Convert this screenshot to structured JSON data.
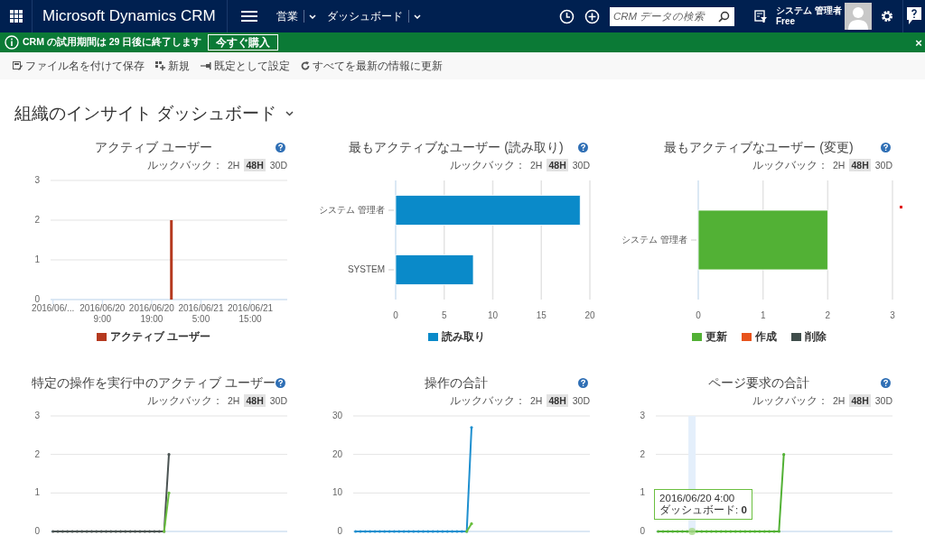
{
  "header": {
    "app_title": "Microsoft Dynamics CRM",
    "nav": [
      {
        "label": "営業"
      },
      {
        "label": "ダッシュボード"
      }
    ],
    "search": {
      "placeholder": "CRM データの検索"
    },
    "user": {
      "name": "システム 管理者",
      "org": "Free"
    }
  },
  "notification": {
    "message": "CRM の試用期間は 29 日後に終了します",
    "button": "今すぐ購入",
    "close": "×"
  },
  "toolbar": [
    {
      "label": "ファイル名を付けて保存",
      "kind": "save"
    },
    {
      "label": "新規",
      "kind": "new"
    },
    {
      "label": "既定として設定",
      "kind": "pin"
    },
    {
      "label": "すべてを最新の情報に更新",
      "kind": "refresh"
    }
  ],
  "dashboard": {
    "title": "組織のインサイト ダッシュボード"
  },
  "panels": [
    {
      "title": "アクティブ ユーザー",
      "lookback_label": "ルックバック：",
      "lookback": [
        {
          "label": "2H",
          "selected": false
        },
        {
          "label": "48H",
          "selected": true
        },
        {
          "label": "30D",
          "selected": false
        }
      ],
      "chart_data": {
        "type": "bar",
        "orientation": "vertical",
        "grid": true,
        "ylim": [
          0,
          3
        ],
        "yticks": [
          0,
          1,
          2,
          3
        ],
        "categories": [
          "2016/06/...",
          null,
          null,
          null,
          null,
          null,
          null,
          null,
          null,
          null,
          "2016/06/20\n9:00",
          null,
          null,
          null,
          null,
          null,
          null,
          null,
          null,
          null,
          "2016/06/20\n19:00",
          null,
          null,
          null,
          null,
          null,
          null,
          null,
          null,
          null,
          "2016/06/21\n5:00",
          null,
          null,
          null,
          null,
          null,
          null,
          null,
          null,
          null,
          "2016/06/21\n15:00",
          null,
          null,
          null,
          null,
          null,
          null,
          null
        ],
        "series": [
          {
            "name": "アクティブ ユーザー",
            "color": "#b5391f",
            "values": [
              null,
              null,
              null,
              null,
              null,
              null,
              null,
              null,
              null,
              null,
              null,
              null,
              null,
              null,
              null,
              null,
              null,
              null,
              null,
              null,
              null,
              null,
              null,
              null,
              2,
              null,
              null,
              null,
              null,
              null,
              null,
              null,
              null,
              null,
              null,
              null,
              null,
              null,
              null,
              null,
              null,
              null,
              null,
              null,
              null,
              null,
              null,
              null
            ]
          }
        ]
      }
    },
    {
      "title": "最もアクティブなユーザー (読み取り)",
      "lookback_label": "ルックバック：",
      "lookback": [
        {
          "label": "2H",
          "selected": false
        },
        {
          "label": "48H",
          "selected": true
        },
        {
          "label": "30D",
          "selected": false
        }
      ],
      "chart_data": {
        "type": "bar",
        "orientation": "horizontal",
        "grid": true,
        "categories": [
          "システム 管理者",
          "SYSTEM"
        ],
        "xlim": [
          0,
          20
        ],
        "xticks": [
          0,
          5,
          10,
          15,
          20
        ],
        "series": [
          {
            "name": "読み取り",
            "color": "#0a8ac9",
            "values": [
              19,
              8
            ]
          }
        ]
      }
    },
    {
      "title": "最もアクティブなユーザー (変更)",
      "lookback_label": "ルックバック：",
      "lookback": [
        {
          "label": "2H",
          "selected": false
        },
        {
          "label": "48H",
          "selected": true
        },
        {
          "label": "30D",
          "selected": false
        }
      ],
      "chart_data": {
        "type": "bar",
        "orientation": "horizontal",
        "grid": true,
        "categories": [
          "システム 管理者"
        ],
        "xlim": [
          0,
          3
        ],
        "xticks": [
          0,
          1,
          2,
          3
        ],
        "series": [
          {
            "name": "更新",
            "color": "#52b135",
            "values": [
              2
            ]
          },
          {
            "name": "作成",
            "color": "#e8531c",
            "values": [
              0
            ]
          },
          {
            "name": "削除",
            "color": "#3f4d4a",
            "values": [
              0
            ]
          }
        ]
      }
    },
    {
      "title": "特定の操作を実行中のアクティブ ユーザー",
      "lookback_label": "ルックバック：",
      "lookback": [
        {
          "label": "2H",
          "selected": false
        },
        {
          "label": "48H",
          "selected": true
        },
        {
          "label": "30D",
          "selected": false
        }
      ],
      "chart_data": {
        "type": "line",
        "grid": true,
        "categories": [
          null,
          null,
          null,
          null,
          null,
          null,
          null,
          null,
          null,
          null,
          null,
          null,
          null,
          null,
          null,
          null,
          null,
          null,
          null,
          null,
          null,
          null,
          null,
          null,
          null,
          null,
          null,
          null,
          null,
          null,
          null,
          null,
          null,
          null,
          null,
          null,
          null,
          null,
          null,
          null,
          null,
          null,
          null,
          null,
          null,
          null,
          null,
          null,
          null
        ],
        "ylim": [
          0,
          3
        ],
        "yticks": [
          0,
          1,
          2,
          3
        ],
        "series": [
          {
            "color": "#4a5352",
            "values": [
              0,
              0,
              0,
              0,
              0,
              0,
              0,
              0,
              0,
              0,
              0,
              0,
              0,
              0,
              0,
              0,
              0,
              0,
              0,
              0,
              0,
              0,
              0,
              0,
              2,
              null,
              null,
              null,
              null,
              null,
              null,
              null,
              null,
              null,
              null,
              null,
              null,
              null,
              null,
              null,
              null,
              null,
              null,
              null,
              null,
              null,
              null,
              null,
              null
            ]
          },
          {
            "color": "#6abf3f",
            "values": [
              null,
              null,
              null,
              null,
              null,
              null,
              null,
              null,
              null,
              null,
              null,
              null,
              null,
              null,
              null,
              null,
              null,
              null,
              null,
              null,
              null,
              null,
              null,
              0,
              1,
              null,
              null,
              null,
              null,
              null,
              null,
              null,
              null,
              null,
              null,
              null,
              null,
              null,
              null,
              null,
              null,
              null,
              null,
              null,
              null,
              null,
              null,
              null,
              null
            ]
          }
        ]
      }
    },
    {
      "title": "操作の合計",
      "lookback_label": "ルックバック：",
      "lookback": [
        {
          "label": "2H",
          "selected": false
        },
        {
          "label": "48H",
          "selected": true
        },
        {
          "label": "30D",
          "selected": false
        }
      ],
      "chart_data": {
        "type": "line",
        "grid": true,
        "categories": [
          null,
          null,
          null,
          null,
          null,
          null,
          null,
          null,
          null,
          null,
          null,
          null,
          null,
          null,
          null,
          null,
          null,
          null,
          null,
          null,
          null,
          null,
          null,
          null,
          null,
          null,
          null,
          null,
          null,
          null,
          null,
          null,
          null,
          null,
          null,
          null,
          null,
          null,
          null,
          null,
          null,
          null,
          null,
          null,
          null,
          null,
          null,
          null,
          null
        ],
        "ylim": [
          0,
          30
        ],
        "yticks": [
          0,
          10,
          20,
          30
        ],
        "series": [
          {
            "color": "#1e8fcf",
            "values": [
              0,
              0,
              0,
              0,
              0,
              0,
              0,
              0,
              0,
              0,
              0,
              0,
              0,
              0,
              0,
              0,
              0,
              0,
              0,
              0,
              0,
              0,
              0,
              0,
              27,
              null,
              null,
              null,
              null,
              null,
              null,
              null,
              null,
              null,
              null,
              null,
              null,
              null,
              null,
              null,
              null,
              null,
              null,
              null,
              null,
              null,
              null,
              null,
              null
            ]
          },
          {
            "color": "#6abf3f",
            "values": [
              null,
              null,
              null,
              null,
              null,
              null,
              null,
              null,
              null,
              null,
              null,
              null,
              null,
              null,
              null,
              null,
              null,
              null,
              null,
              null,
              null,
              null,
              null,
              0,
              2,
              null,
              null,
              null,
              null,
              null,
              null,
              null,
              null,
              null,
              null,
              null,
              null,
              null,
              null,
              null,
              null,
              null,
              null,
              null,
              null,
              null,
              null,
              null,
              null
            ]
          }
        ]
      }
    },
    {
      "title": "ページ要求の合計",
      "lookback_label": "ルックバック：",
      "lookback": [
        {
          "label": "2H",
          "selected": false
        },
        {
          "label": "48H",
          "selected": true
        },
        {
          "label": "30D",
          "selected": false
        }
      ],
      "tooltip": {
        "title": "2016/06/20 4:00",
        "text": "ダッシュボード: **0**"
      },
      "chart_data": {
        "type": "line",
        "grid": true,
        "categories": [
          null,
          null,
          null,
          null,
          null,
          null,
          null,
          null,
          null,
          null,
          null,
          null,
          null,
          null,
          null,
          null,
          null,
          null,
          null,
          null,
          null,
          null,
          null,
          null,
          null,
          null,
          null,
          null,
          null,
          null,
          null,
          null,
          null,
          null,
          null,
          null,
          null,
          null,
          null,
          null,
          null,
          null,
          null,
          null,
          null,
          null,
          null,
          null,
          null
        ],
        "ylim": [
          0,
          3
        ],
        "yticks": [
          0,
          1,
          2,
          3
        ],
        "series": [
          {
            "color": "#52b135",
            "values": [
              0,
              0,
              0,
              0,
              0,
              0,
              0,
              0,
              0,
              0,
              0,
              0,
              0,
              0,
              0,
              0,
              0,
              0,
              0,
              0,
              0,
              0,
              0,
              0,
              0,
              0,
              2,
              null,
              null,
              null,
              null,
              null,
              null,
              null,
              null,
              null,
              null,
              null,
              null,
              null,
              null,
              null,
              null,
              null,
              null,
              null,
              null,
              null,
              null
            ]
          }
        ]
      }
    }
  ]
}
